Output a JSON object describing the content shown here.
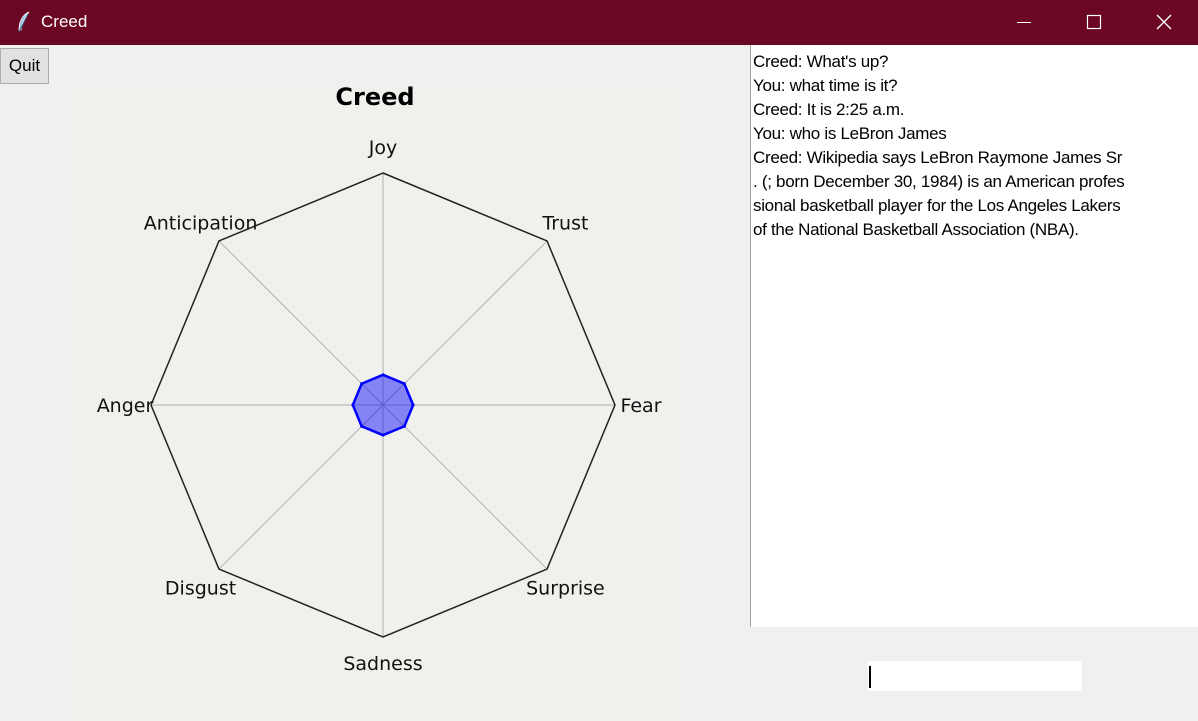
{
  "window": {
    "title": "Creed"
  },
  "toolbar": {
    "quit_label": "Quit"
  },
  "chart_data": {
    "type": "radar",
    "title": "Creed",
    "categories": [
      "Joy",
      "Trust",
      "Fear",
      "Surprise",
      "Sadness",
      "Disgust",
      "Anger",
      "Anticipation"
    ],
    "series": [
      {
        "values": [
          0.13,
          0.13,
          0.13,
          0.13,
          0.13,
          0.13,
          0.13,
          0.13
        ],
        "color": "#0000ff"
      }
    ],
    "rlim": [
      0,
      1
    ],
    "grid": true
  },
  "chat": {
    "lines": [
      "Creed: What's up?",
      "You: what time is it?",
      "Creed: It is 2:25 a.m.",
      "You: who is LeBron James",
      "Creed: Wikipedia says LeBron Raymone James Sr",
      ". (; born December 30, 1984) is an American profes",
      "sional basketball player for the Los Angeles Lakers",
      "of the National Basketball Association (NBA)."
    ]
  },
  "input": {
    "value": ""
  }
}
